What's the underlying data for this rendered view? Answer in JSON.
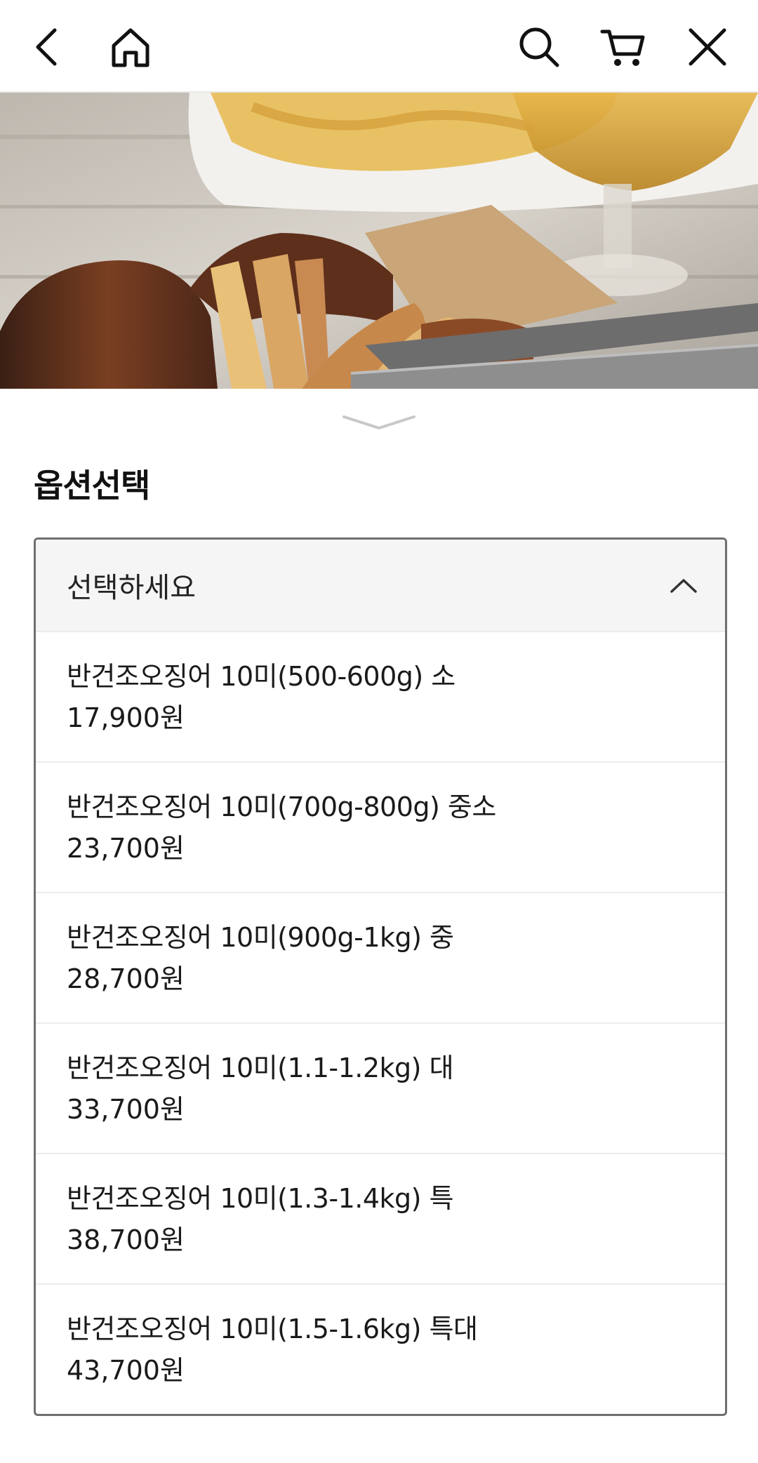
{
  "header": {
    "back_icon": "chevron-left-icon",
    "home_icon": "home-icon",
    "search_icon": "search-icon",
    "cart_icon": "cart-icon",
    "close_icon": "close-icon"
  },
  "hero": {
    "image_subject": "grilled dried squid with fries and beer",
    "collapse_icon": "chevron-down-icon"
  },
  "options_section": {
    "title": "옵션선택",
    "select": {
      "placeholder": "선택하세요",
      "toggle_icon": "chevron-up-icon",
      "options": [
        {
          "name": "반건조오징어 10미(500-600g) 소",
          "price": "17,900원"
        },
        {
          "name": "반건조오징어 10미(700g-800g) 중소",
          "price": "23,700원"
        },
        {
          "name": "반건조오징어 10미(900g-1kg) 중",
          "price": "28,700원"
        },
        {
          "name": "반건조오징어 10미(1.1-1.2kg) 대",
          "price": "33,700원"
        },
        {
          "name": "반건조오징어 10미(1.3-1.4kg) 특",
          "price": "38,700원"
        },
        {
          "name": "반건조오징어 10미(1.5-1.6kg) 특대",
          "price": "43,700원"
        }
      ]
    }
  },
  "colors": {
    "border": "#6f6f6f",
    "header_bg": "#f5f5f5",
    "text": "#1a1a1a"
  }
}
